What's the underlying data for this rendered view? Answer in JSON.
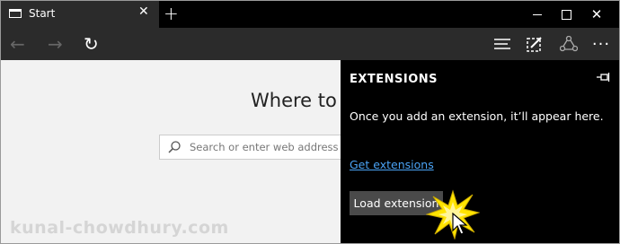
{
  "tab": {
    "title": "Start",
    "icon": "tab-window-icon"
  },
  "titlebar": {
    "close_glyph": "✕",
    "new_tab_glyph": "+"
  },
  "navbar": {
    "back_glyph": "←",
    "forward_glyph": "→",
    "refresh_glyph": "↻",
    "more_glyph": "···"
  },
  "content": {
    "heading": "Where to n",
    "search_placeholder": "Search or enter web address"
  },
  "extensions_panel": {
    "title": "EXTENSIONS",
    "message": "Once you add an extension, it’ll appear here.",
    "get_extensions_link": "Get extensions",
    "load_button": "Load extension",
    "link_color": "#4aa3f5"
  },
  "watermark": "kunal-chowdhury.com"
}
